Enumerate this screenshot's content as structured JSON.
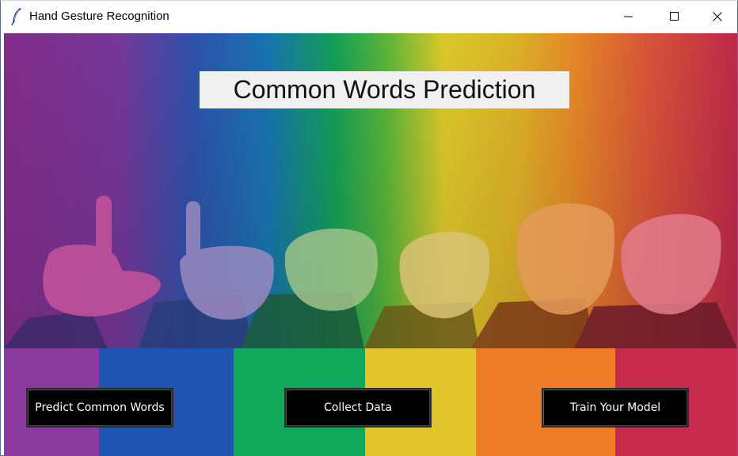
{
  "window": {
    "title": "Hand Gesture Recognition",
    "controls": {
      "minimize_icon": "minimize-icon",
      "maximize_icon": "maximize-icon",
      "close_icon": "close-icon"
    }
  },
  "banner": {
    "heading": "Common Words Prediction"
  },
  "actions": {
    "predict_label": "Predict Common Words",
    "collect_label": "Collect Data",
    "train_label": "Train Your Model"
  },
  "colors": {
    "purple": "#8a3b9c",
    "blue": "#1f55b0",
    "green": "#10a85a",
    "yellow": "#e2c42d",
    "orange": "#ef7d28",
    "red": "#c72b4d",
    "button_bg": "#000000",
    "button_text": "#ffffff"
  }
}
